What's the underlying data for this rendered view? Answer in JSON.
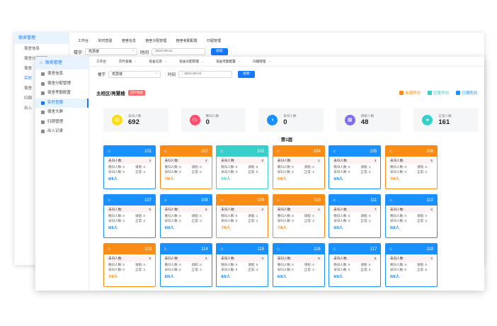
{
  "back": {
    "side_head": "宿舍管理",
    "side_items": [
      "宿舍信息",
      "宿舍分配管理",
      "宿舍",
      "实时",
      "宿舍",
      "归宿",
      "出入"
    ],
    "tabs": [
      "工作台",
      "实时查寝",
      "宿舍信息",
      "宿舍分配管理",
      "宿舍考勤配置",
      "归寝管理"
    ],
    "filter_label": "楼宇",
    "filter_value": "亮慧楼",
    "time_label": "时间",
    "date_value": "2024-06-21",
    "search_label": "搜索"
  },
  "sidebar": {
    "head": "宿舍管理",
    "items": [
      {
        "label": "宿舍信息",
        "active": false
      },
      {
        "label": "宿舍分配管理",
        "active": false
      },
      {
        "label": "宿舍考勤配置",
        "active": false
      },
      {
        "label": "实时查寝",
        "active": true
      },
      {
        "label": "宿舍大屏",
        "active": false
      },
      {
        "label": "归宿管理",
        "active": false
      },
      {
        "label": "出入记录",
        "active": false
      }
    ]
  },
  "tabs": [
    "工作台",
    "实时查寝",
    "宿舍信息",
    "宿舍分配管理",
    "宿舍考勤配置",
    "归寝管理"
  ],
  "filter": {
    "building_label": "楼宇",
    "building_value": "亮慧楼",
    "time_label": "时间",
    "date_value": "2024-06-21",
    "search_label": "搜索"
  },
  "header": {
    "title": "主校区/亮慧楼",
    "badge": "实时数据"
  },
  "legend": [
    {
      "label": "未满房间",
      "color": "#fa8c16"
    },
    {
      "label": "空置房间",
      "color": "#36cfc9"
    },
    {
      "label": "已满房间",
      "color": "#1890ff"
    }
  ],
  "stats": [
    {
      "label": "未归人数",
      "value": "692",
      "color": "#fadb14",
      "icon": "clipboard-icon"
    },
    {
      "label": "晚归人数",
      "value": "0",
      "color": "#ff4d6d",
      "icon": "clock-icon"
    },
    {
      "label": "早归人数",
      "value": "0",
      "color": "#1890ff",
      "icon": "sun-icon"
    },
    {
      "label": "请假人数",
      "value": "48",
      "color": "#7c6cf2",
      "icon": "leave-icon"
    },
    {
      "label": "正常人数",
      "value": "161",
      "color": "#36cfc9",
      "icon": "user-icon"
    }
  ],
  "floor_label": "第1层",
  "room_labels": {
    "unreturned": "未归人数:",
    "late": "晚归人数:",
    "early": "早归人数:",
    "leave": "请假:",
    "normal": "正常:"
  },
  "rooms": [
    {
      "num": "101",
      "status": "full",
      "unreturned": "4",
      "late": "0",
      "leave": "0",
      "early": "0",
      "normal": "4",
      "occupancy": "8/8人"
    },
    {
      "num": "102",
      "status": "partial",
      "unreturned": "4",
      "late": "0",
      "leave": "0",
      "early": "0",
      "normal": "3",
      "occupancy": "7/8人"
    },
    {
      "num": "103",
      "status": "empty",
      "unreturned": "0",
      "late": "0",
      "leave": "0",
      "early": "0",
      "normal": "0",
      "occupancy": "0/8人"
    },
    {
      "num": "104",
      "status": "partial",
      "unreturned": "1",
      "late": "0",
      "leave": "0",
      "early": "0",
      "normal": "4",
      "occupancy": "5/8人"
    },
    {
      "num": "105",
      "status": "full",
      "unreturned": "4",
      "late": "0",
      "leave": "1",
      "early": "0",
      "normal": "3",
      "occupancy": "8/8人"
    },
    {
      "num": "106",
      "status": "partial",
      "unreturned": "5",
      "late": "0",
      "leave": "0",
      "early": "0",
      "normal": "2",
      "occupancy": "7/8人"
    },
    {
      "num": "107",
      "status": "full",
      "unreturned": "6",
      "late": "0",
      "leave": "0",
      "early": "0",
      "normal": "2",
      "occupancy": "8/8人"
    },
    {
      "num": "108",
      "status": "full",
      "unreturned": "5",
      "late": "0",
      "leave": "0",
      "early": "0",
      "normal": "3",
      "occupancy": "8/8人"
    },
    {
      "num": "109",
      "status": "partial",
      "unreturned": "2",
      "late": "0",
      "leave": "1",
      "early": "0",
      "normal": "4",
      "occupancy": "7/8人"
    },
    {
      "num": "110",
      "status": "partial",
      "unreturned": "4",
      "late": "0",
      "leave": "0",
      "early": "0",
      "normal": "3",
      "occupancy": "7/8人"
    },
    {
      "num": "111",
      "status": "full",
      "unreturned": "7",
      "late": "0",
      "leave": "0",
      "early": "0",
      "normal": "1",
      "occupancy": "8/8人"
    },
    {
      "num": "112",
      "status": "full",
      "unreturned": "6",
      "late": "0",
      "leave": "0",
      "early": "0",
      "normal": "2",
      "occupancy": "8/8人"
    },
    {
      "num": "113",
      "status": "partial",
      "unreturned": "5",
      "late": "0",
      "leave": "0",
      "early": "0",
      "normal": "2",
      "occupancy": "7/8人"
    },
    {
      "num": "114",
      "status": "full",
      "unreturned": "4",
      "late": "0",
      "leave": "0",
      "early": "0",
      "normal": "4",
      "occupancy": "8/8人"
    },
    {
      "num": "115",
      "status": "full",
      "unreturned": "4",
      "late": "0",
      "leave": "0",
      "early": "0",
      "normal": "4",
      "occupancy": "8/8人"
    },
    {
      "num": "116",
      "status": "full",
      "unreturned": "5",
      "late": "0",
      "leave": "0",
      "early": "0",
      "normal": "3",
      "occupancy": "8/8人"
    },
    {
      "num": "117",
      "status": "full",
      "unreturned": "5",
      "late": "0",
      "leave": "0",
      "early": "0",
      "normal": "3",
      "occupancy": "8/8人"
    },
    {
      "num": "118",
      "status": "full",
      "unreturned": "2",
      "late": "0",
      "leave": "0",
      "early": "0",
      "normal": "6",
      "occupancy": "8/8人"
    }
  ],
  "status_colors": {
    "full": "#1890ff",
    "partial": "#fa8c16",
    "empty": "#36cfc9"
  }
}
